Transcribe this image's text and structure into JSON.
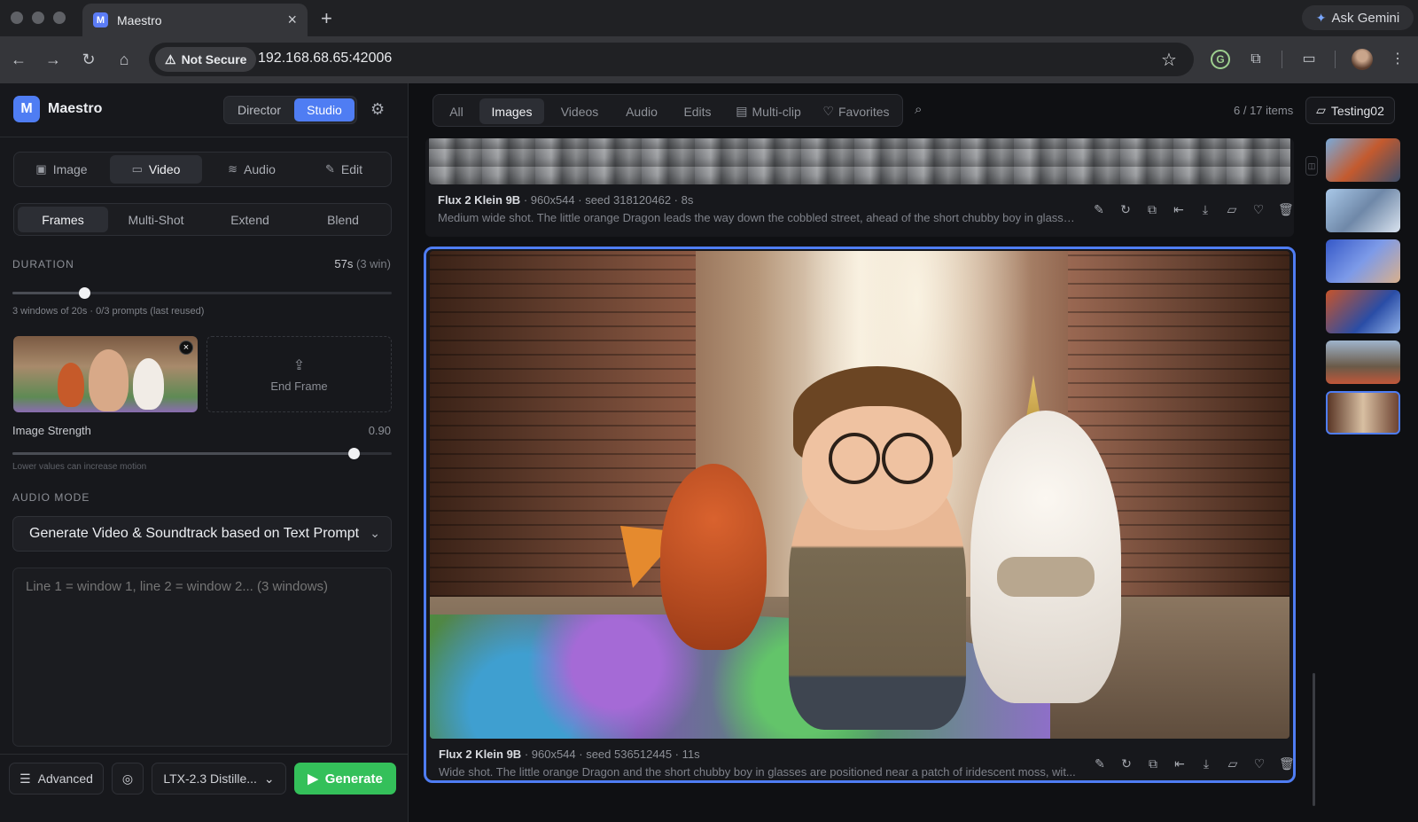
{
  "browser": {
    "tab_title": "Maestro",
    "tab_favicon_letter": "M",
    "new_tab": "+",
    "ask_gemini": "Ask Gemini",
    "security_label": "Not Secure",
    "url": "192.168.68.65:42006"
  },
  "app": {
    "logo_letter": "M",
    "name": "Maestro",
    "modes": [
      "Director",
      "Studio"
    ],
    "active_mode": "Studio"
  },
  "left_panel": {
    "media_tabs": [
      {
        "label": "Image",
        "icon": "image-icon"
      },
      {
        "label": "Video",
        "icon": "video-icon"
      },
      {
        "label": "Audio",
        "icon": "audio-waveform-icon"
      },
      {
        "label": "Edit",
        "icon": "magic-wand-icon"
      }
    ],
    "active_media_tab": "Video",
    "video_tabs": [
      "Frames",
      "Multi-Shot",
      "Extend",
      "Blend"
    ],
    "active_video_tab": "Frames",
    "duration_label": "DURATION",
    "duration_value": "57s",
    "duration_windows": "(3 win)",
    "duration_slider_fraction": 0.19,
    "duration_hint": "3 windows of 20s · 0/3 prompts (last reused)",
    "end_frame_label": "End Frame",
    "image_strength_label": "Image Strength",
    "image_strength_value": "0.90",
    "image_strength_fraction": 0.9,
    "strength_hint": "Lower values can increase motion",
    "audio_mode_label": "AUDIO MODE",
    "audio_mode_selected": "Generate Video & Soundtrack based on Text Prompt",
    "prompt_placeholder": "Line 1 = window 1, line 2 = window 2... (3 windows)",
    "advanced_label": "Advanced",
    "model_label": "LTX-2.3 Distille...",
    "generate_label": "Generate"
  },
  "main": {
    "filters": [
      {
        "label": "All"
      },
      {
        "label": "Images"
      },
      {
        "label": "Videos"
      },
      {
        "label": "Audio"
      },
      {
        "label": "Edits"
      },
      {
        "label": "Multi-clip",
        "icon": "film-icon"
      },
      {
        "label": "Favorites",
        "icon": "heart-icon"
      }
    ],
    "active_filter": "Images",
    "item_count": "6 / 17 items",
    "folder_name": "Testing02",
    "cards": [
      {
        "model": "Flux 2 Klein 9B",
        "details": " · 960x544 · seed 318120462 · 8s",
        "caption": "Medium wide shot. The little orange Dragon leads the way down the cobbled street, ahead of the short chubby boy in glasses..."
      },
      {
        "model": "Flux 2 Klein 9B",
        "details": " · 960x544 · seed 536512445 · 11s",
        "caption": "Wide shot. The little orange Dragon and the short chubby boy in glasses are positioned near a patch of iridescent moss, wit..."
      }
    ],
    "card_actions": [
      "edit-icon",
      "regenerate-icon",
      "copy-icon",
      "set-frame-icon",
      "download-icon",
      "move-to-folder-icon",
      "favorite-icon",
      "delete-icon"
    ]
  },
  "colors": {
    "accent": "#4f7df3",
    "generate": "#34c05a"
  }
}
